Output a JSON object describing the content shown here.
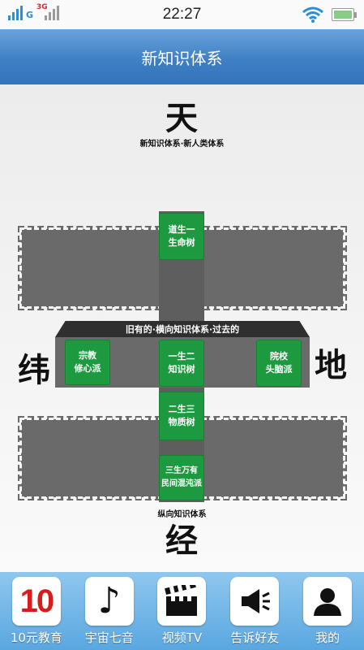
{
  "status": {
    "network_1": "G",
    "network_2": "3G",
    "time": "22:27"
  },
  "header": {
    "title": "新知识体系"
  },
  "diagram": {
    "top_char": "天",
    "top_label": "新知识体系·新人类体系",
    "left_char": "纬",
    "right_char": "地",
    "bottom_char": "经",
    "bottom_label": "纵向知识体系",
    "band_label": "旧有的·横向知识体系·过去的",
    "boxes": {
      "dao": "道生一\n生命树",
      "religion": "宗教\n修心派",
      "one_two": "一生二\n知识树",
      "academy": "院校\n头脑派",
      "two_three": "二生三\n物质树",
      "three_all": "三生万有\n民间混沌派"
    }
  },
  "nav": {
    "items": [
      {
        "label": "10元教育",
        "icon_text": "10",
        "icon": "ten-icon"
      },
      {
        "label": "宇宙七音",
        "icon_text": "♪",
        "icon": "music-note-icon"
      },
      {
        "label": "视频TV",
        "icon": "clapperboard-icon"
      },
      {
        "label": "告诉好友",
        "icon": "megaphone-icon"
      },
      {
        "label": "我的",
        "icon": "person-icon"
      }
    ]
  },
  "colors": {
    "header_blue": "#3f7fc4",
    "nav_blue": "#5aa7e0",
    "box_green": "#1d9a3f",
    "band_gray": "#6a6a6a",
    "ten_red": "#d81c1c"
  }
}
